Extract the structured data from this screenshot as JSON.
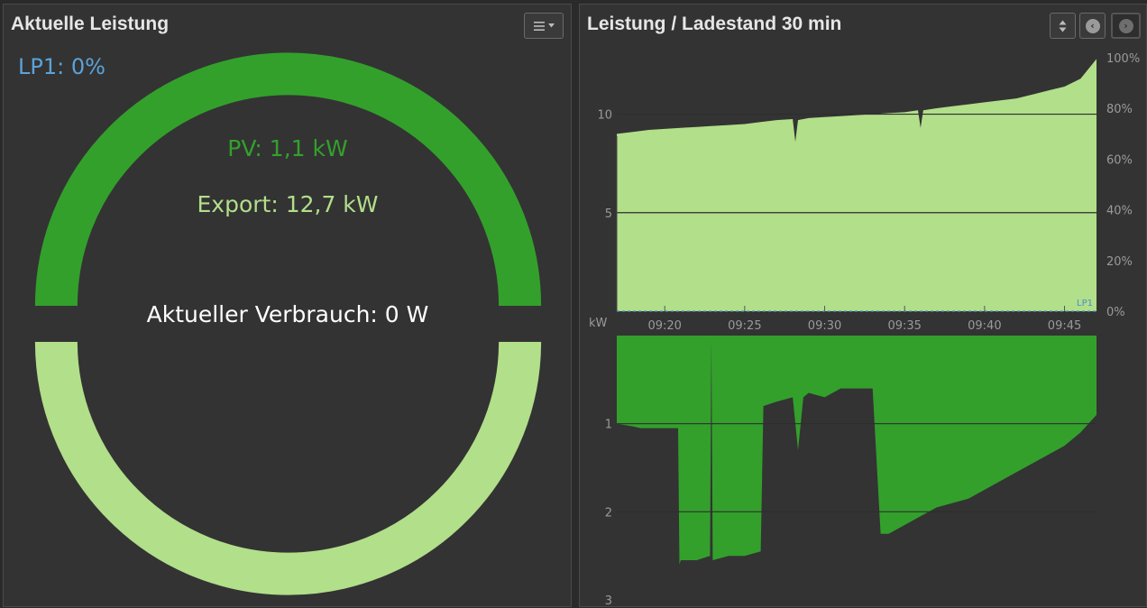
{
  "left_panel": {
    "title": "Aktuelle Leistung",
    "menu_icon": "hamburger-dropdown-icon",
    "lp_label": "LP1: 0%",
    "pv_label": "PV: 1,1 kW",
    "export_label": "Export: 12,7 kW",
    "consumption_label": "Aktueller Verbrauch: 0 W",
    "colors": {
      "pv": "#33a02c",
      "export": "#b2df8a",
      "lp": "#5ba3d9",
      "consumption": "#ffffff"
    }
  },
  "right_panel": {
    "title": "Leistung / Ladestand 30 min",
    "buttons": {
      "sort_icon": "sort-updown-icon",
      "prev_icon": "chevron-left-icon",
      "next_icon": "chevron-right-icon"
    }
  },
  "chart_data": [
    {
      "type": "area",
      "y_axis_left": {
        "ticks": [
          "10",
          "5"
        ],
        "unit_label": "kW",
        "ylim": [
          0,
          13
        ]
      },
      "y_axis_right": {
        "ticks": [
          "100%",
          "80%",
          "60%",
          "40%",
          "20%",
          "0%"
        ],
        "ylim": [
          0,
          100
        ]
      },
      "x_tick_labels": [
        "09:20",
        "09:25",
        "09:30",
        "09:35",
        "09:40",
        "09:45"
      ],
      "xlim": [
        "09:17",
        "09:47"
      ],
      "lp_series_label": "LP1",
      "series": [
        {
          "color": "#b2df8a",
          "x": [
            "09:17",
            "09:18",
            "09:19",
            "09:20",
            "09:21",
            "09:22",
            "09:23",
            "09:24",
            "09:25",
            "09:26",
            "09:27",
            "09:28",
            "09:28:10",
            "09:28:20",
            "09:29",
            "09:30",
            "09:31",
            "09:32",
            "09:33",
            "09:34",
            "09:35",
            "09:35:50",
            "09:36",
            "09:36:10",
            "09:37",
            "09:38",
            "09:39",
            "09:40",
            "09:41",
            "09:42",
            "09:43",
            "09:44",
            "09:45",
            "09:46",
            "09:47"
          ],
          "values": [
            9.0,
            9.1,
            9.2,
            9.25,
            9.3,
            9.35,
            9.4,
            9.45,
            9.5,
            9.6,
            9.7,
            9.75,
            8.6,
            9.7,
            9.8,
            9.85,
            9.9,
            9.95,
            10.0,
            10.05,
            10.1,
            10.2,
            9.3,
            10.2,
            10.3,
            10.4,
            10.5,
            10.6,
            10.7,
            10.8,
            11.0,
            11.2,
            11.4,
            11.8,
            12.8
          ]
        }
      ]
    },
    {
      "type": "area",
      "y_axis_left": {
        "ticks": [
          "1",
          "2",
          "3"
        ],
        "ylim": [
          0,
          3
        ]
      },
      "x_tick_labels": [],
      "series": [
        {
          "color": "#33a02c",
          "x": [
            "09:17",
            "09:18",
            "09:18:30",
            "09:20:50",
            "09:20:55",
            "09:21",
            "09:22",
            "09:22:50",
            "09:22:55",
            "09:23",
            "09:24",
            "09:25",
            "09:26",
            "09:26:10",
            "09:27",
            "09:28",
            "09:28:20",
            "09:28:40",
            "09:29",
            "09:30",
            "09:31",
            "09:32",
            "09:33",
            "09:33:30",
            "09:34",
            "09:35",
            "09:36",
            "09:37",
            "09:38",
            "09:39",
            "09:40",
            "09:41",
            "09:42",
            "09:43",
            "09:44",
            "09:45",
            "09:46",
            "09:47"
          ],
          "values": [
            1.0,
            1.03,
            1.05,
            1.05,
            2.6,
            2.55,
            2.55,
            2.5,
            0.05,
            2.55,
            2.5,
            2.5,
            2.45,
            0.8,
            0.75,
            0.7,
            1.3,
            0.7,
            0.65,
            0.7,
            0.6,
            0.6,
            0.6,
            2.25,
            2.25,
            2.15,
            2.05,
            1.95,
            1.9,
            1.85,
            1.75,
            1.65,
            1.55,
            1.45,
            1.35,
            1.25,
            1.1,
            0.9
          ]
        }
      ]
    }
  ]
}
